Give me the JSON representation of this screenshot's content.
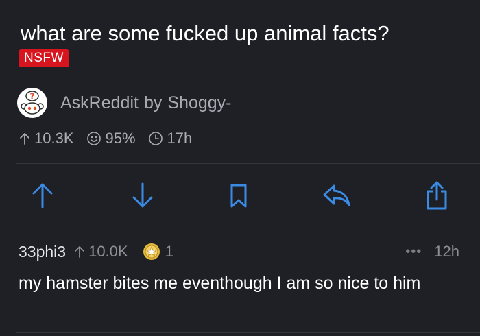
{
  "post": {
    "title": "what are some fucked up animal facts?",
    "nsfw_label": "NSFW",
    "subreddit": "AskReddit",
    "by": "by",
    "author": "Shoggy-",
    "stats": {
      "score": "10.3K",
      "upvote_ratio": "95%",
      "age": "17h"
    }
  },
  "actions": [
    "upvote",
    "downvote",
    "save",
    "reply",
    "share"
  ],
  "comment": {
    "author": "33phi3",
    "score": "10.0K",
    "award_count": "1",
    "more": "•••",
    "age": "12h",
    "body": "my hamster bites me eventhough I am so nice to him"
  },
  "colors": {
    "background": "#1e2026",
    "accent_blue": "#3b8be5",
    "nsfw_red": "#d6151e",
    "muted_text": "#a9abb2",
    "award_gold": "#e3b93c"
  },
  "icons": {
    "upvote": "arrow-up-icon",
    "downvote": "arrow-down-icon",
    "save": "bookmark-icon",
    "reply": "reply-icon",
    "share": "share-icon",
    "ratio": "smiley-icon",
    "age": "clock-icon",
    "award": "award-icon"
  }
}
